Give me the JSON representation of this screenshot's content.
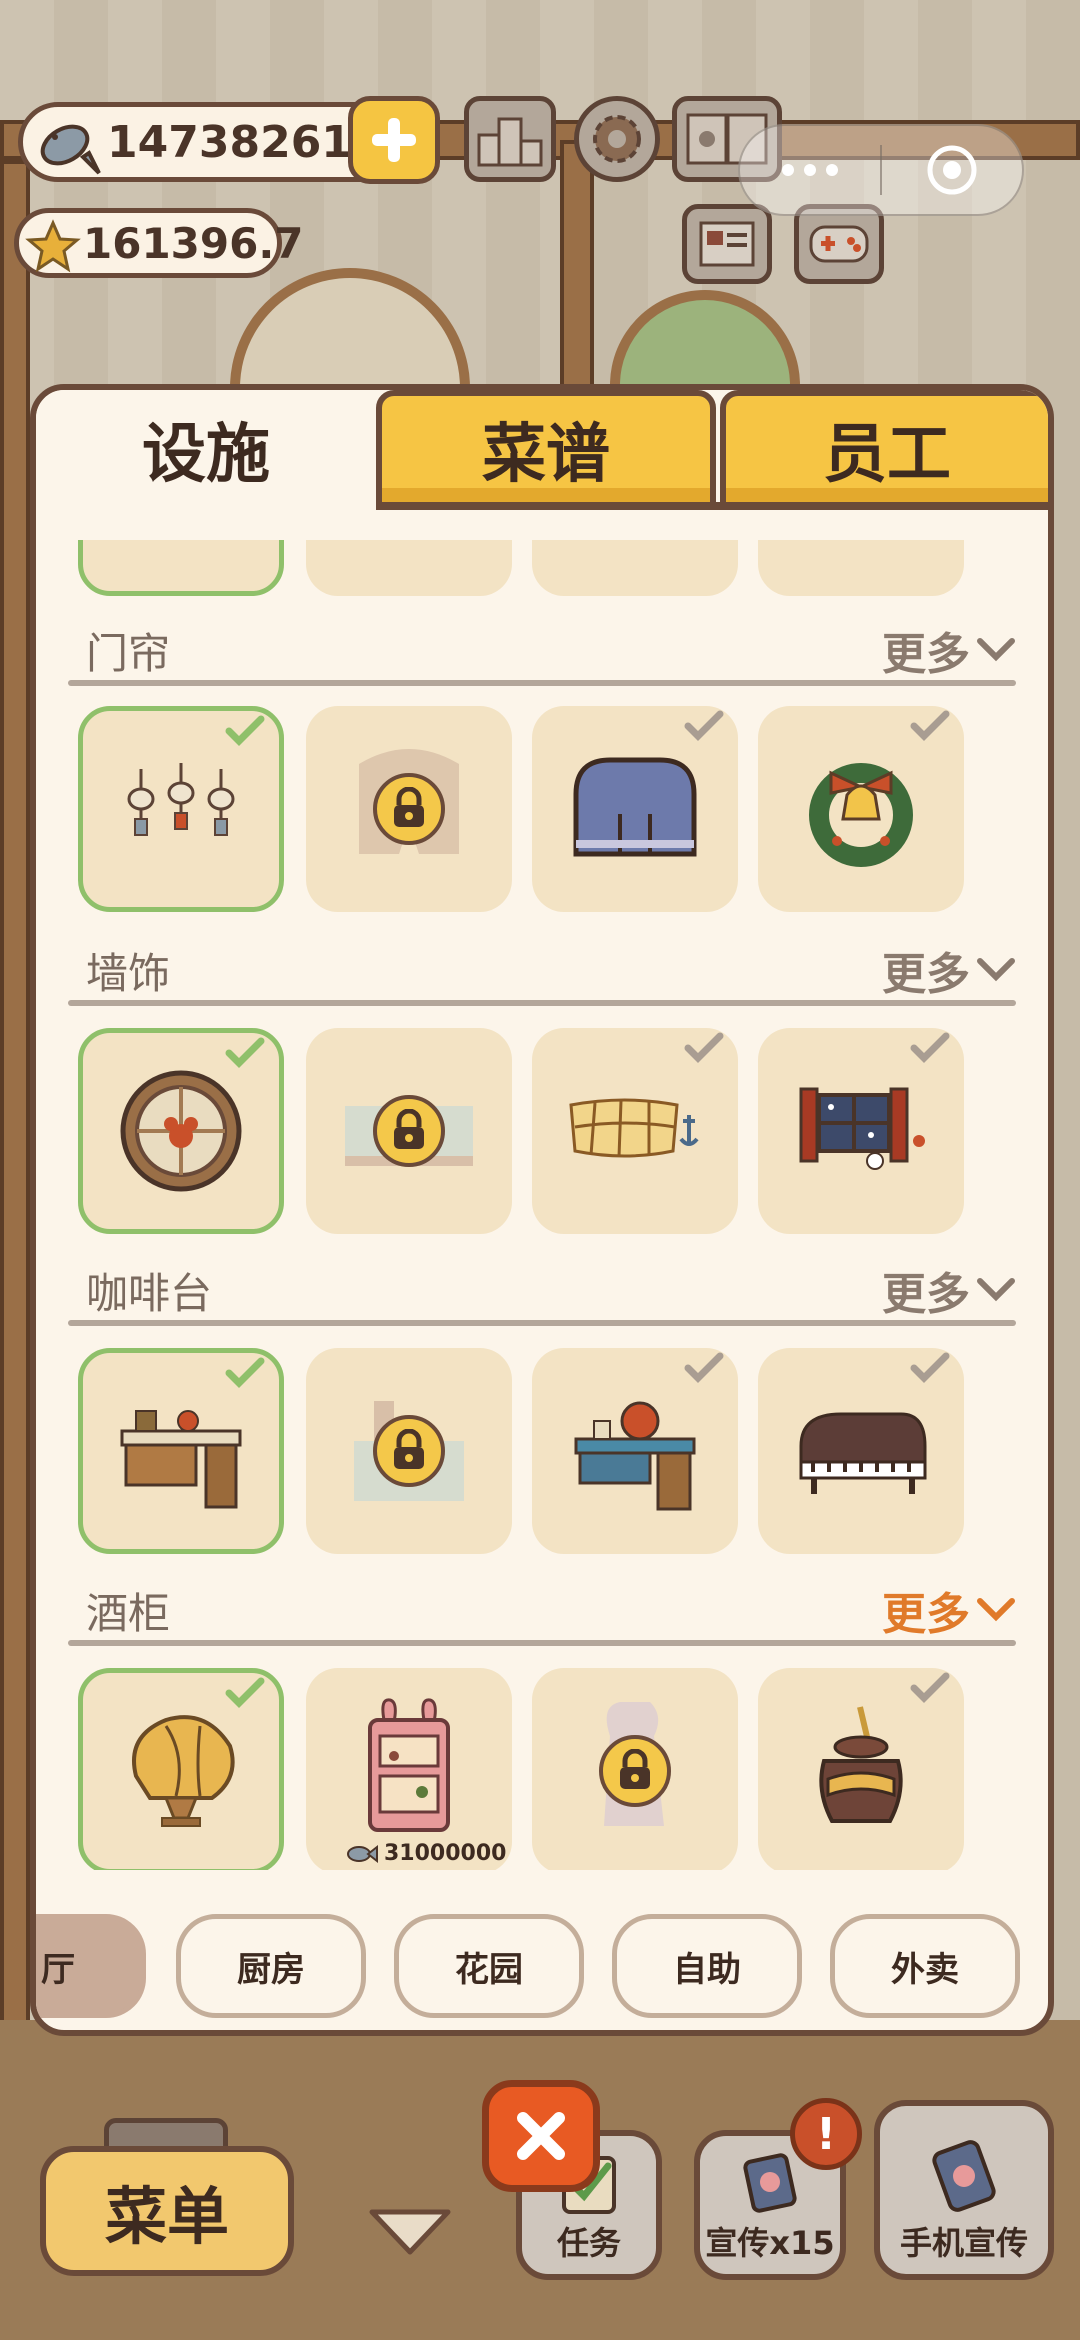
{
  "currency": {
    "fish_amount": "147382615",
    "star_amount": "161396.7"
  },
  "tabs": [
    {
      "label": "设施",
      "active": true
    },
    {
      "label": "菜谱",
      "active": false
    },
    {
      "label": "员工",
      "active": false
    }
  ],
  "categories": [
    {
      "title": "门帘",
      "more": "更多",
      "more_active": false
    },
    {
      "title": "墙饰",
      "more": "更多",
      "more_active": false
    },
    {
      "title": "咖啡台",
      "more": "更多",
      "more_active": false
    },
    {
      "title": "酒柜",
      "more": "更多",
      "more_active": true
    }
  ],
  "price_label": "31000000",
  "rooms": {
    "current": "厅",
    "items": [
      "厨房",
      "花园",
      "自助",
      "外卖"
    ]
  },
  "bottom": {
    "menu": "菜单",
    "task": "任务",
    "promo": "宣传x15",
    "phone_promo": "手机宣传",
    "badge": "!"
  },
  "colors": {
    "accent_yellow": "#f6c544",
    "selected_green": "#8fc06a",
    "more_orange": "#e07a2a",
    "close_orange": "#e85a23"
  }
}
